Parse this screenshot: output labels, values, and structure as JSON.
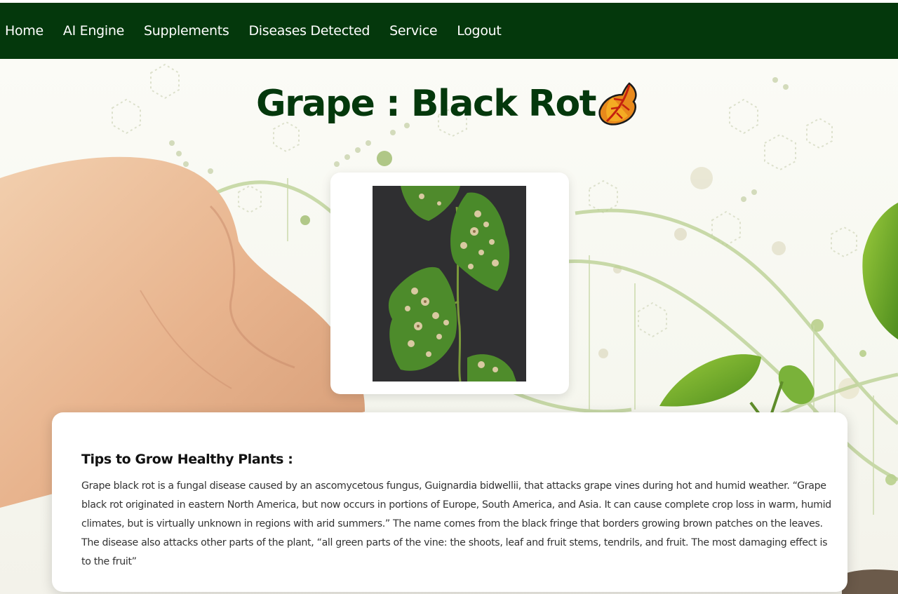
{
  "nav": {
    "items": [
      {
        "label": "Home"
      },
      {
        "label": "AI Engine"
      },
      {
        "label": "Supplements"
      },
      {
        "label": "Diseases Detected"
      },
      {
        "label": "Service"
      },
      {
        "label": "Logout"
      }
    ]
  },
  "page": {
    "title": "Grape : Black Rot",
    "title_icon": "fallen-leaf-emoji"
  },
  "disease_image": {
    "subject": "grape-leaves-black-rot-photo"
  },
  "tips": {
    "heading": "Tips to Grow Healthy Plants :",
    "body": "Grape black rot is a fungal disease caused by an ascomycetous fungus, Guignardia bidwellii, that attacks grape vines during hot and humid weather. “Grape black rot originated in eastern North America, but now occurs in portions of Europe, South America, and Asia. It can cause complete crop loss in warm, humid climates, but is virtually unknown in regions with arid summers.” The name comes from the black fringe that borders growing brown patches on the leaves. The disease also attacks other parts of the plant, “all green parts of the vine: the shoots, leaf and fruit stems, tendrils, and fruit. The most damaging effect is to the fruit”"
  },
  "colors": {
    "navbar": "#04380c",
    "title": "#04380c",
    "nav_text": "#ffffff"
  }
}
